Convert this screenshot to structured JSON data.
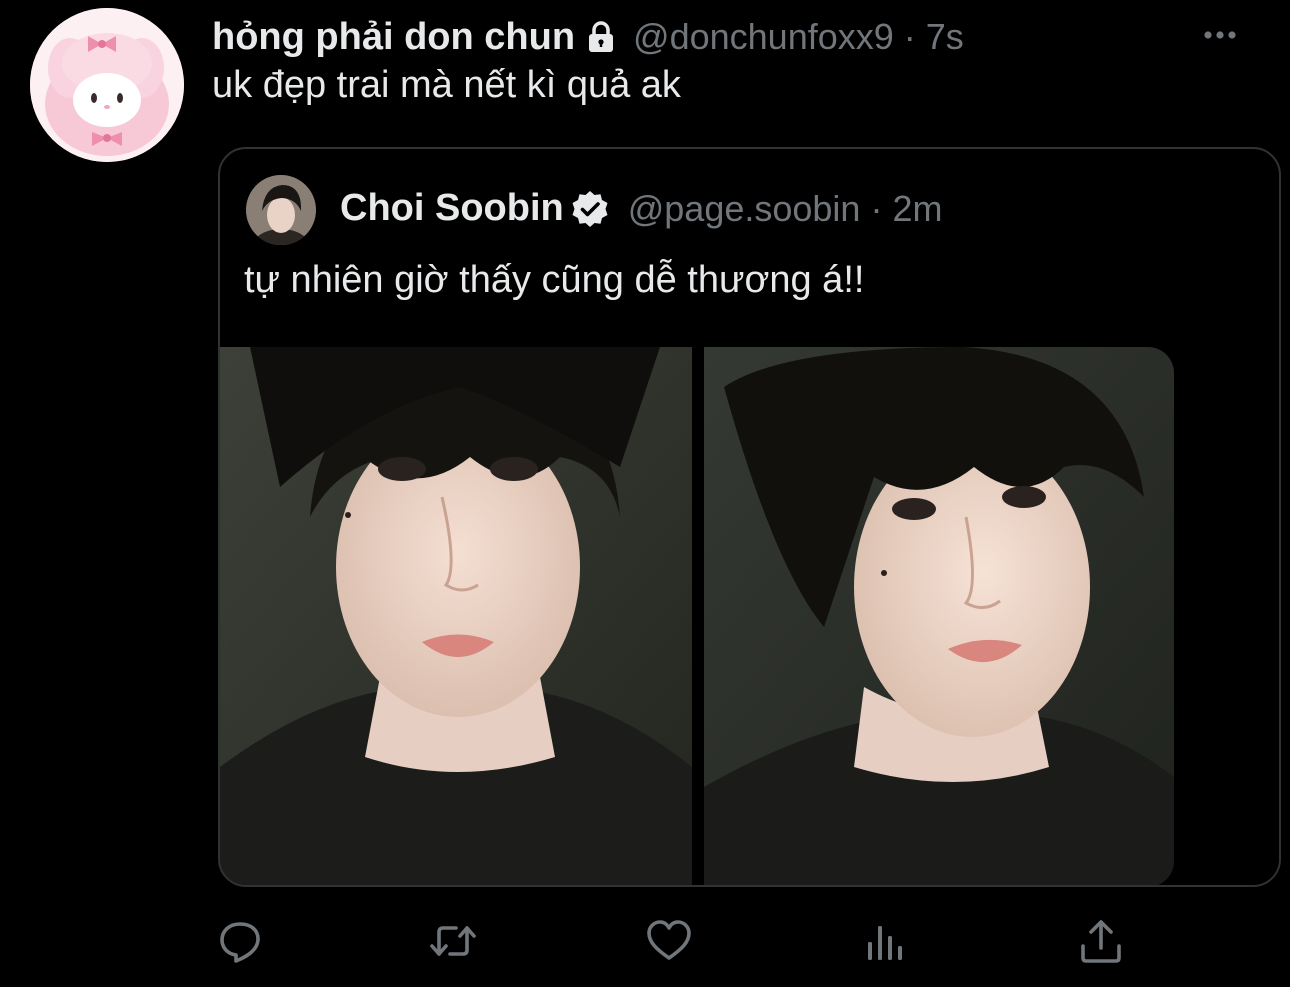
{
  "tweet": {
    "display_name": "hỏng phải don chun",
    "handle": "@donchunfoxx9",
    "separator": "·",
    "time": "7s",
    "text": "uk đẹp trai mà nết kì quả ak",
    "avatar_icon": "pink-bunny-avatar",
    "lock_icon": "lock-icon",
    "more_icon": "more-horizontal-icon"
  },
  "quoted_tweet": {
    "display_name": "Choi Soobin",
    "verified_icon": "verified-badge-icon",
    "handle": "@page.soobin",
    "separator": "·",
    "time": "2m",
    "text": "tự nhiên giờ thấy cũng dễ thương á!!",
    "media_count": 2
  },
  "actions": [
    {
      "name": "reply",
      "icon": "reply-icon"
    },
    {
      "name": "retweet",
      "icon": "retweet-icon"
    },
    {
      "name": "like",
      "icon": "heart-icon"
    },
    {
      "name": "analytics",
      "icon": "analytics-icon"
    },
    {
      "name": "share",
      "icon": "share-icon"
    }
  ],
  "colors": {
    "background": "#000000",
    "primary_text": "#e7e9ea",
    "secondary_text": "#71767b",
    "border": "#2f3336"
  }
}
